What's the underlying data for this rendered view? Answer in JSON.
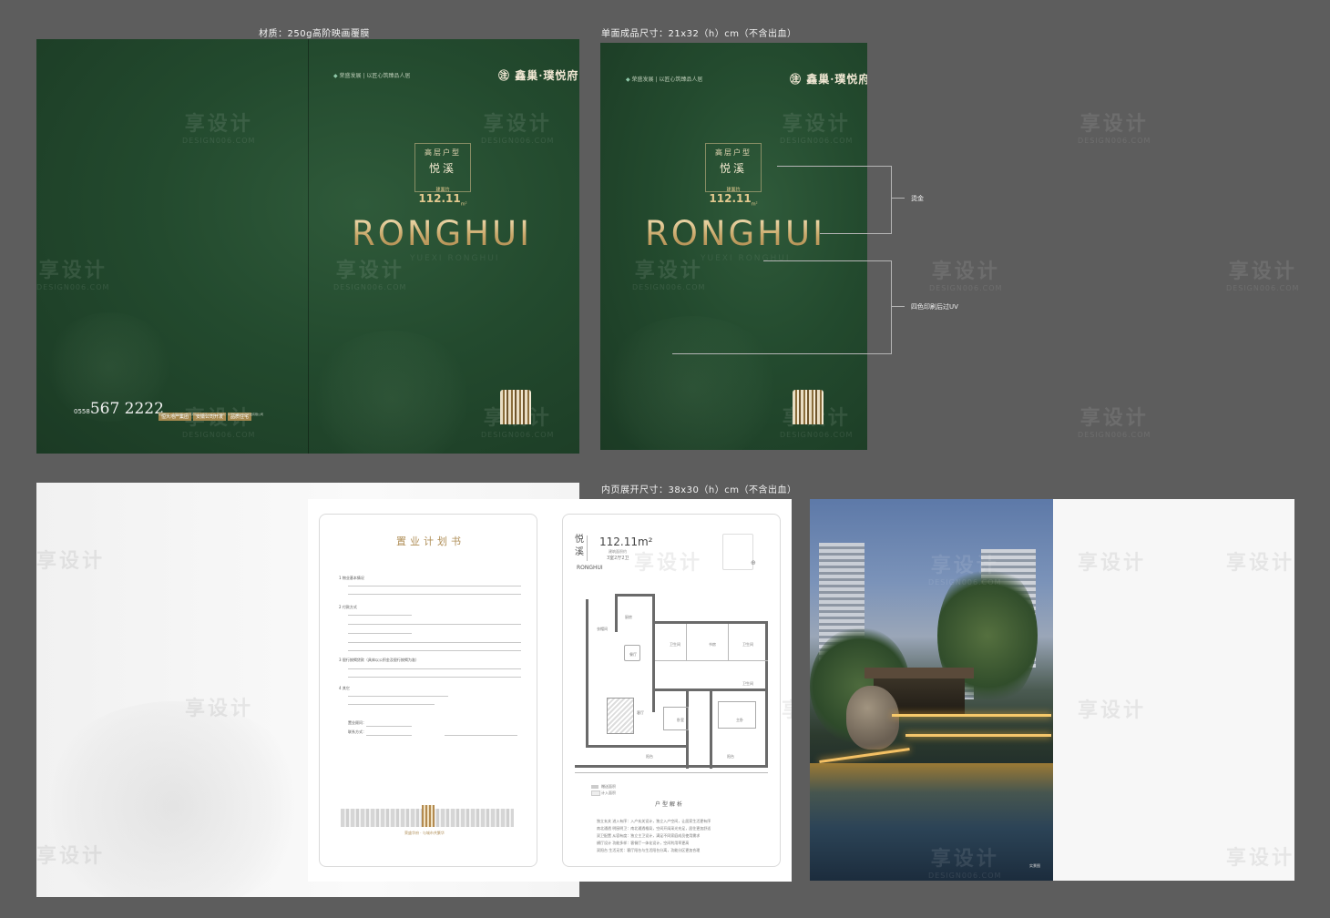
{
  "specs": {
    "material": "材质：250g高阶映画覆膜",
    "single_size": "单面成品尺寸：21x32（h）cm（不含出血）",
    "spread_size": "内页展开尺寸：38x30（h）cm（不含出血）"
  },
  "cover": {
    "developer_logos": "荣盛发展",
    "slogan": "以匠心筑臻品人居",
    "brand_name": "鑫巢·璞悦府",
    "unit_type": "高层户型",
    "unit_name": "悦溪",
    "area_prefix": "建面约",
    "area_value": "112.11",
    "area_unit": "m²",
    "title": "RONGHUI",
    "subtitle": "YUEXI RONGHUI",
    "phone_prefix": "0558",
    "phone_number": "567 2222",
    "tags": [
      "恒大地产集团",
      "安徽公司开发",
      "品质住宅"
    ],
    "address": "项目地址：阜阳市颍州区清河路与北京路交汇处 开发商：阜阳荣盛房地产开发有限公司"
  },
  "annotations": {
    "hot_stamp": "烫金",
    "four_color_uv": "四色印刷后过UV"
  },
  "watermark": {
    "cn": "享设计",
    "en": "DESIGN006.COM"
  },
  "form": {
    "title": "置业计划书",
    "sections": [
      "1 物业基本情况",
      "2 付款方式",
      "3 银行按揭贷款（具体以公积金及银行按揭为准）",
      "4 其它",
      "置业顾问：",
      "联系方式："
    ],
    "footer": "荣盛华府 · 与城市共繁华"
  },
  "floorplan": {
    "name_char1": "悦",
    "name_char2": "溪",
    "area": "112.11m²",
    "area_note": "建筑面积约",
    "layout": "3室2厅2卫",
    "brand": "RONGHUI",
    "rooms": [
      "厨房",
      "餐厅",
      "卫生间",
      "书房",
      "卫生间",
      "客厅",
      "卧室",
      "主卧",
      "阳台",
      "阳台",
      "衣帽间",
      "卫生间"
    ],
    "legend": [
      "赠送面积",
      "计入面积"
    ],
    "analysis_title": "户型解析",
    "analysis_lines": [
      "独立玄关 进入有序：入户玄关设计，独立入户空间，让居家生活更有序",
      "南北通透 明厨明卫：南北通透格局，空间开阔采光充足，居住更加舒适",
      "双卫配置 从容有度：独立主卫设计，满足不同家庭成员使用需求",
      "横厅设计 功能多样：客餐厅一体化设计，空间利用率更高",
      "双阳台 生活无忧：客厅阳台与生活阳台分离，功能分区更加合理"
    ]
  },
  "photo": {
    "caption": "实景图"
  }
}
